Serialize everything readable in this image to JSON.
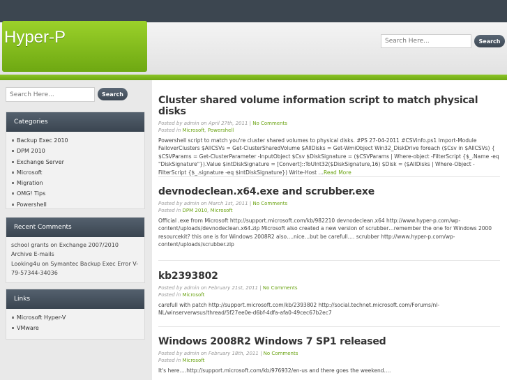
{
  "site": {
    "title": "Hyper-P"
  },
  "header_search": {
    "placeholder": "Search Here...",
    "button": "Search"
  },
  "sidebar_search": {
    "placeholder": "Search Here...",
    "button": "Search"
  },
  "categories": {
    "title": "Categories",
    "items": [
      "Backup Exec 2010",
      "DPM 2010",
      "Exchange Server",
      "Microsoft",
      "Migration",
      "OMG! Tips",
      "Powershell"
    ]
  },
  "recent_comments": {
    "title": "Recent Comments",
    "items": [
      {
        "author": "school grants",
        "on": "on",
        "post": "Exchange 2007/2010 Archive E-mails"
      },
      {
        "author": "Looking4u",
        "on": "on",
        "post": "Symantec Backup Exec Error V-79-57344-34036"
      }
    ]
  },
  "links": {
    "title": "Links",
    "items": [
      "Microsoft Hyper-V",
      "VMware"
    ]
  },
  "posts": [
    {
      "title": "Cluster shared volume information script to match physical disks",
      "posted_by": "Posted by",
      "author": "admin",
      "on": "on",
      "date": "April 27th, 2011",
      "sep": "|",
      "comments": "No Comments",
      "posted_in": "Posted in",
      "cats": [
        "Microsoft",
        "Powershell"
      ],
      "excerpt": "Powershell script to match you're cluster shared volumes to physical disks. #PS 27-04-2011 #CSVinfo.ps1 Import-Module FailoverClusters $AllCSVs = Get-ClusterSharedVolume $AllDisks = Get-WmiObject Win32_DiskDrive foreach ($Csv in $AllCSVs) { $CSVParams = Get-ClusterParameter -InputObject $Csv $DiskSignature = ($CSVParams | Where-object -FilterScript {$_.Name -eq \"DiskSignature\"}).Value $intDiskSignature = [Convert]::ToUInt32($DiskSignature,16) $Disk = ($AllDisks | Where-Object -FilterScript {$_.signature -eq $intDiskSignature}) Write-Host …",
      "read_more": "Read More"
    },
    {
      "title": "devnodeclean.x64.exe and scrubber.exe",
      "posted_by": "Posted by",
      "author": "admin",
      "on": "on",
      "date": "March 1st, 2011",
      "sep": "|",
      "comments": "No Comments",
      "posted_in": "Posted in",
      "cats": [
        "DPM 2010",
        "Microsoft"
      ],
      "excerpt": "Official .exe from Microsoft http://support.microsoft.com/kb/982210 devnodeclean.x64 http://www.hyper-p.com/wp-content/uploads/devnodeclean.x64.zip Microsoft also created a new version of scrubber…remember the one for Windows 2000 resourcekit? this one is for Windows 2008R2 also….nice…but be carefull…. scrubber http://www.hyper-p.com/wp-content/uploads/scrubber.zip"
    },
    {
      "title": "kb2393802",
      "posted_by": "Posted by",
      "author": "admin",
      "on": "on",
      "date": "February 21st, 2011",
      "sep": "|",
      "comments": "No Comments",
      "posted_in": "Posted in",
      "cats": [
        "Microsoft"
      ],
      "excerpt": "carefull with patch http://support.microsoft.com/kb/2393802 http://social.technet.microsoft.com/Forums/nl-NL/winserverwsus/thread/5f27ee0e-d6bf-4dfa-afa0-49cec67b2ec7"
    },
    {
      "title": "Windows 2008R2 Windows 7 SP1 released",
      "posted_by": "Posted by",
      "author": "admin",
      "on": "on",
      "date": "February 18th, 2011",
      "sep": "|",
      "comments": "No Comments",
      "posted_in": "Posted in",
      "cats": [
        "Microsoft"
      ],
      "excerpt": "It's here….http://support.microsoft.com/kb/976932/en-us and there goes the weekend…."
    }
  ],
  "colors": {
    "brand_green": "#7cb81c",
    "dark_header": "#3c4650",
    "link": "#6aa312"
  }
}
